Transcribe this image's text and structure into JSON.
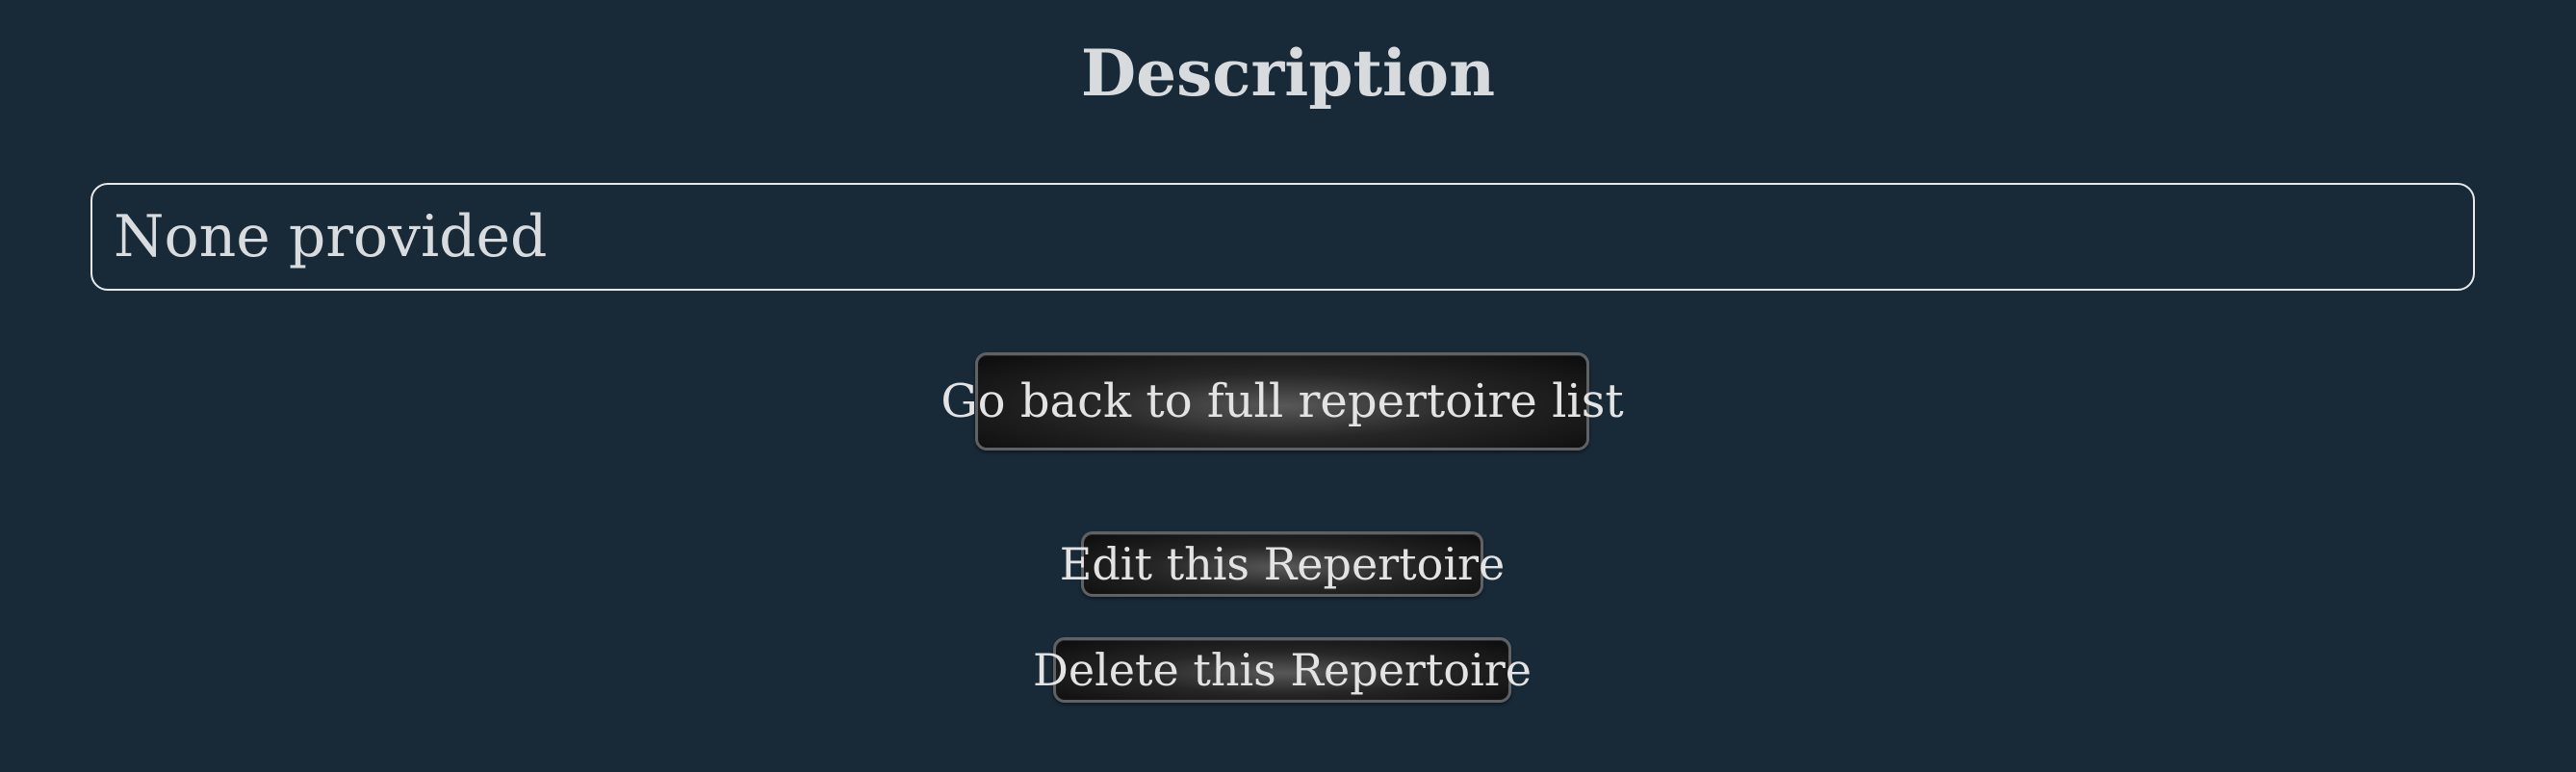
{
  "description_section": {
    "heading": "Description",
    "value": "None provided"
  },
  "actions": {
    "back_label": "Go back to full repertoire list",
    "edit_label": "Edit this Repertoire",
    "delete_label": "Delete this Repertoire"
  },
  "colors": {
    "background": "#182937",
    "text": "#d9dcdf",
    "box_border": "#e6e9ec",
    "button_dark": "#0c0c0c",
    "button_border": "#5f6264"
  }
}
